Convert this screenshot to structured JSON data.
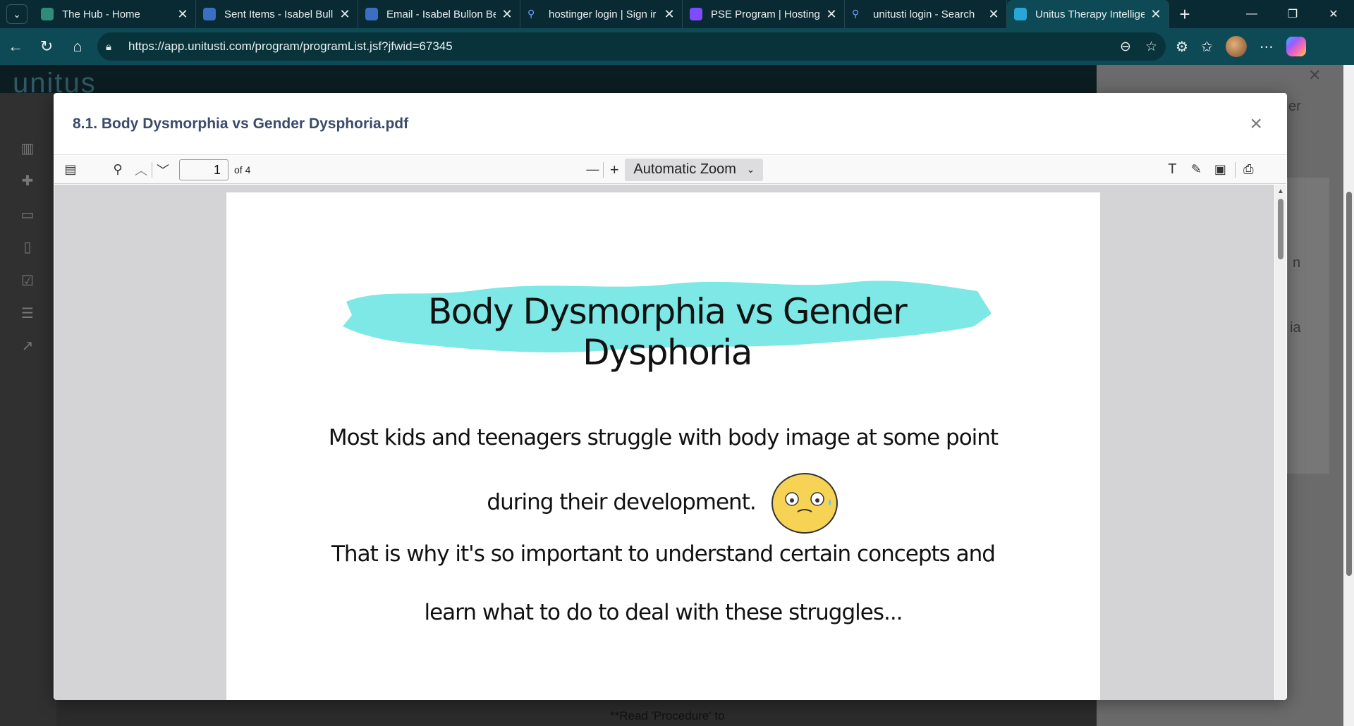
{
  "browser": {
    "tabs": [
      {
        "title": "The Hub - Home",
        "color": "#2f8b7a"
      },
      {
        "title": "Sent Items - Isabel Bull",
        "color": "#3a6fc4"
      },
      {
        "title": "Email - Isabel Bullon Be",
        "color": "#3a6fc4"
      },
      {
        "title": "hostinger login | Sign ir",
        "color": "#2a5aa8"
      },
      {
        "title": "PSE Program | Hosting",
        "color": "#7d4cff"
      },
      {
        "title": "unitusti login - Search",
        "color": "#2a5aa8"
      },
      {
        "title": "Unitus Therapy Intellige",
        "color": "#2aa5d8"
      }
    ],
    "url": "https://app.unitusti.com/program/programList.jsf?jfwid=67345"
  },
  "background": {
    "logo": "unitus",
    "footer_text": "**Read 'Procedure' to",
    "right_fragments": [
      "er",
      "n",
      "ia"
    ]
  },
  "modal": {
    "title": "8.1. Body Dysmorphia vs Gender Dysphoria.pdf",
    "close_label": "×"
  },
  "pdf_toolbar": {
    "page_number": "1",
    "page_count": "of 4",
    "zoom": "Automatic Zoom"
  },
  "document": {
    "title": "Body Dysmorphia vs Gender Dysphoria",
    "line1": "Most kids and teenagers struggle with body image at some point",
    "line2": "during their development.",
    "line3": "That is why it's so important to understand certain concepts and",
    "line4": "learn what to do to deal with these struggles...",
    "brush_color": "#7de8e5",
    "emoji_color": "#f6d354"
  }
}
